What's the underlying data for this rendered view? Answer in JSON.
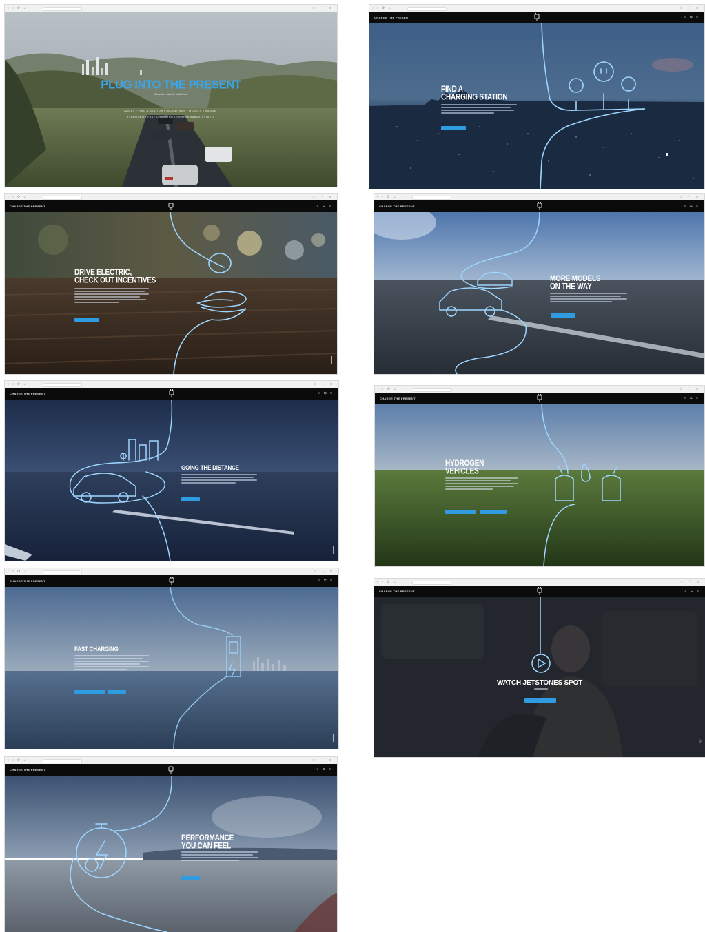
{
  "browser": {
    "nav_glyphs": "‹ › ⟳ ⌂",
    "tool_glyphs": "☆ ⋮ ≡"
  },
  "site": {
    "brand": "CHARGE THE PRESENT",
    "menu_glyphs": "⌕ ⇆ ≡"
  },
  "hero": {
    "title": "PLUG INTO THE PRESENT",
    "subtitle": "Discover electric with Ford",
    "nav_row_1": "ABOUT  •  FIND A STATION  •  INCENTIVES  •  MODELS  •  RANGE",
    "nav_row_2": "HYDROGEN  •  FAST CHARGING  •  PERFORMANCE  •  VIDEO"
  },
  "panels": {
    "charging_station": "FIND A\nCHARGING STATION",
    "incentives": "DRIVE ELECTRIC,\nCHECK OUT INCENTIVES",
    "models": "MORE MODELS\nON THE WAY",
    "distance": "GOING THE DISTANCE",
    "hydrogen": "HYDROGEN\nVEHICLES",
    "fast_charging": "FAST CHARGING",
    "watch": "WATCH JETSTONES SPOT",
    "performance": "PERFORMANCE\nYOU CAN FEEL"
  },
  "social_glyphs": "f\nt\n◎"
}
